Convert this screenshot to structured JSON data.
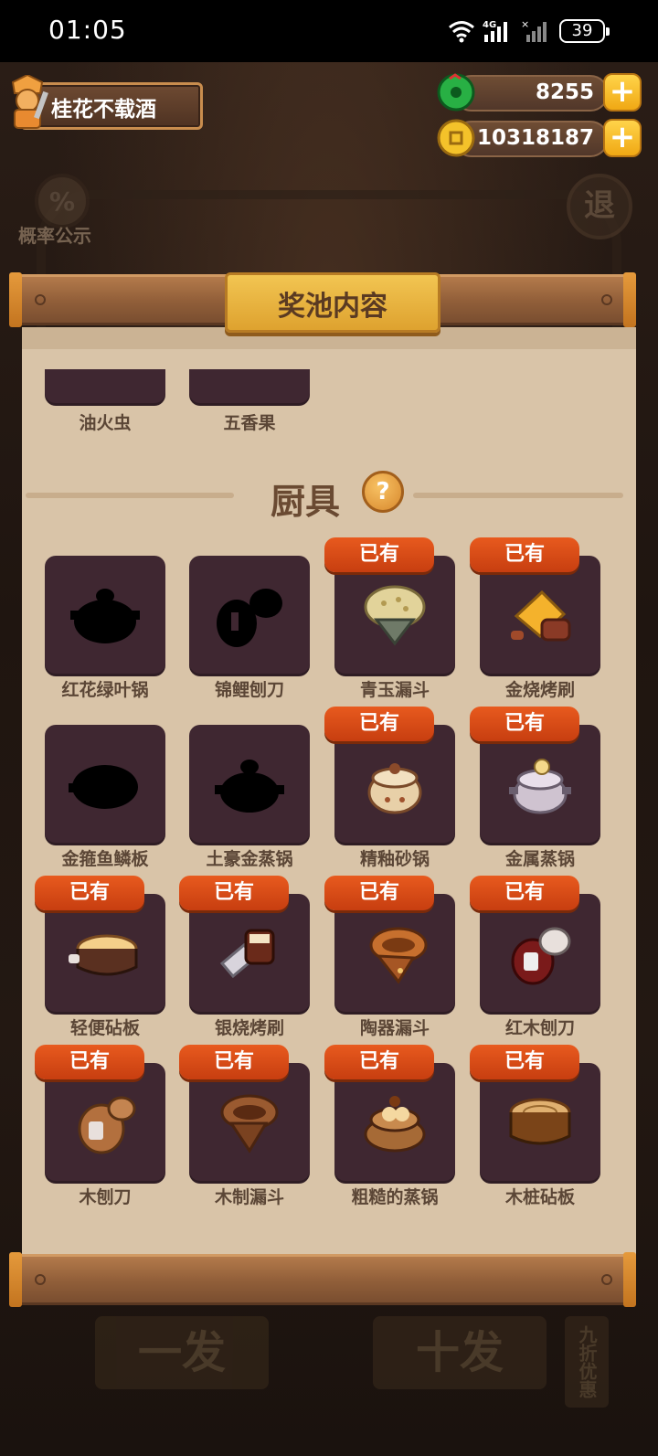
{
  "status_bar": {
    "time": "01:05",
    "network": "4G",
    "battery": "39"
  },
  "player": {
    "name": "桂花不载酒"
  },
  "currency": {
    "jade": {
      "value": "8255",
      "icon": "jade-coin-icon"
    },
    "gold": {
      "value": "10318187",
      "icon": "gold-coin-icon"
    }
  },
  "background": {
    "prob_label": "概率公示",
    "exit_label": "退",
    "single_draw": "一发",
    "ten_draw": "十发",
    "discount": "九折优惠"
  },
  "panel": {
    "title": "奖池内容"
  },
  "partial_row": [
    {
      "name": "油火虫"
    },
    {
      "name": "五香果"
    }
  ],
  "section": {
    "title": "厨具",
    "help": "?"
  },
  "owned_label": "已有",
  "items": [
    {
      "name": "红花绿叶锅",
      "owned": false,
      "icon": "pot-silhouette"
    },
    {
      "name": "锦鲤刨刀",
      "owned": false,
      "icon": "plane-silhouette"
    },
    {
      "name": "青玉漏斗",
      "owned": true,
      "icon": "jade-funnel"
    },
    {
      "name": "金烧烤刷",
      "owned": true,
      "icon": "gold-brush"
    },
    {
      "name": "金箍鱼鳞板",
      "owned": false,
      "icon": "board-silhouette"
    },
    {
      "name": "土豪金蒸锅",
      "owned": false,
      "icon": "steamer-silhouette"
    },
    {
      "name": "精釉砂锅",
      "owned": true,
      "icon": "glazed-pot"
    },
    {
      "name": "金属蒸锅",
      "owned": true,
      "icon": "metal-steamer"
    },
    {
      "name": "轻便砧板",
      "owned": true,
      "icon": "light-board"
    },
    {
      "name": "银烧烤刷",
      "owned": true,
      "icon": "silver-brush"
    },
    {
      "name": "陶器漏斗",
      "owned": true,
      "icon": "clay-funnel"
    },
    {
      "name": "红木刨刀",
      "owned": true,
      "icon": "redwood-plane"
    },
    {
      "name": "木刨刀",
      "owned": true,
      "icon": "wood-plane"
    },
    {
      "name": "木制漏斗",
      "owned": true,
      "icon": "wood-funnel"
    },
    {
      "name": "粗糙的蒸锅",
      "owned": true,
      "icon": "rough-steamer"
    },
    {
      "name": "木桩砧板",
      "owned": true,
      "icon": "stump-board"
    }
  ]
}
